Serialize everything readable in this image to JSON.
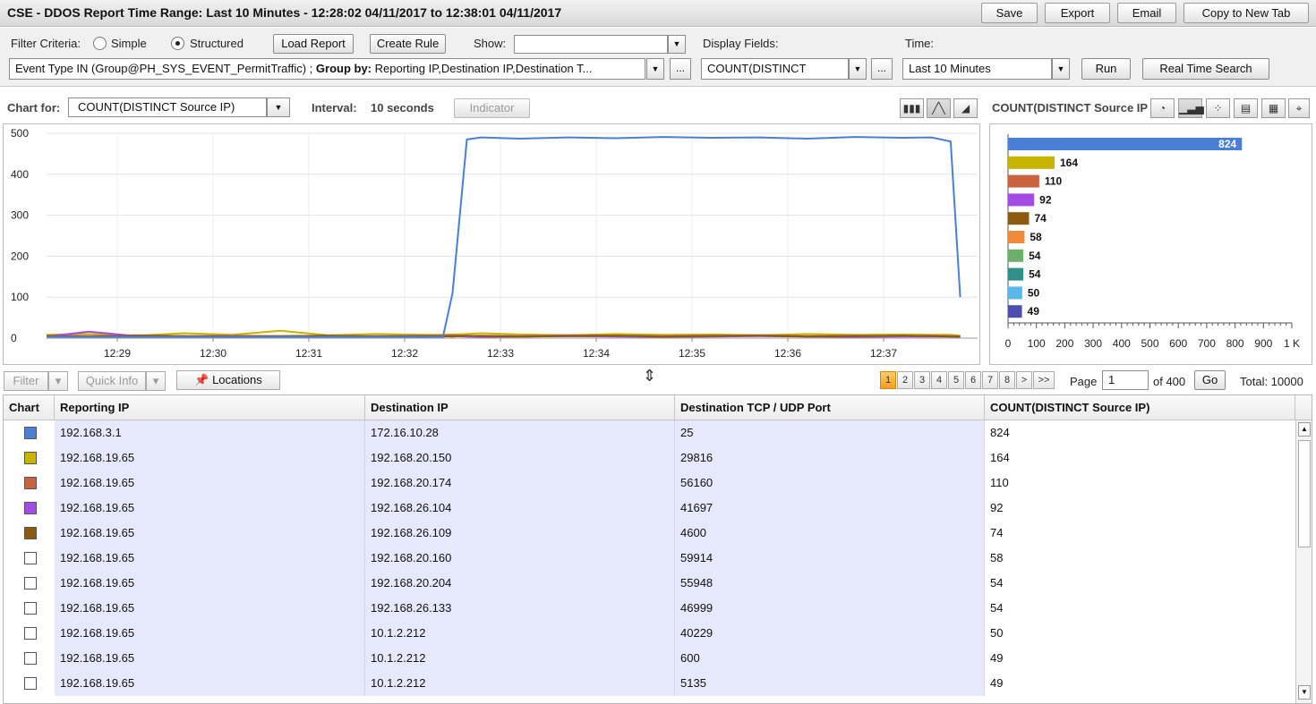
{
  "window": {
    "title": "CSE - DDOS Report  Time Range: Last 10 Minutes - 12:28:02 04/11/2017 to 12:38:01 04/11/2017",
    "buttons": {
      "save": "Save",
      "export": "Export",
      "email": "Email",
      "copy": "Copy to New Tab"
    }
  },
  "filter": {
    "label": "Filter Criteria:",
    "simple": "Simple",
    "structured": "Structured",
    "selected_mode": "Structured",
    "load_report": "Load Report",
    "create_rule": "Create Rule",
    "show_label": "Show:",
    "show_value": "",
    "criteria_prefix": "Event Type IN (Group@PH_SYS_EVENT_PermitTraffic) ; ",
    "group_by_label": "Group by:",
    "group_by_value": " Reporting IP,Destination IP,Destination T...",
    "display_fields_label": "Display Fields:",
    "display_fields_value": "COUNT(DISTINCT",
    "time_label": "Time:",
    "time_value": "Last 10 Minutes",
    "run": "Run",
    "real_time_search": "Real Time Search",
    "ellipsis": "..."
  },
  "chart_controls": {
    "chart_for_label": "Chart for:",
    "chart_for_value": "COUNT(DISTINCT Source IP)",
    "interval_label": "Interval:",
    "interval_value": "10 seconds",
    "indicator": "Indicator",
    "side_title": "COUNT(DISTINCT Source IP",
    "cursor_glyph": "⇕"
  },
  "chart_data": [
    {
      "type": "line",
      "title": "",
      "xlabel": "",
      "ylabel": "",
      "ylim": [
        0,
        500
      ],
      "yticks": [
        "0",
        "100",
        "200",
        "300",
        "400",
        "500"
      ],
      "xticks": [
        "12:29",
        "12:30",
        "12:31",
        "12:32",
        "12:33",
        "12:34",
        "12:35",
        "12:36",
        "12:37"
      ],
      "grid": true,
      "x_minutes": [
        0,
        0.5,
        1.0,
        1.5,
        2.0,
        2.5,
        3.0,
        3.5,
        4.0,
        4.2,
        4.3,
        4.45,
        4.6,
        5.0,
        5.5,
        6.0,
        6.5,
        7.0,
        7.5,
        8.0,
        8.5,
        9.0,
        9.3,
        9.5,
        9.6
      ],
      "series": [
        {
          "color": "#4a7fd6",
          "values": [
            3,
            3,
            3,
            3,
            3,
            3,
            3,
            3,
            3,
            3,
            110,
            485,
            490,
            487,
            490,
            488,
            491,
            489,
            490,
            487,
            491,
            489,
            490,
            480,
            100
          ]
        },
        {
          "color": "#c8b400",
          "values": [
            8,
            10,
            6,
            12,
            8,
            18,
            7,
            10,
            8,
            8,
            9,
            10,
            12,
            9,
            7,
            10,
            8,
            9,
            7,
            10,
            8,
            9,
            8,
            8,
            6
          ]
        },
        {
          "color": "#c8623f",
          "values": [
            6,
            5,
            7,
            5,
            6,
            5,
            6,
            5,
            6,
            6,
            7,
            5,
            6,
            5,
            7,
            6,
            5,
            6,
            7,
            5,
            6,
            5,
            6,
            5,
            5
          ]
        },
        {
          "color": "#a44be6",
          "values": [
            4,
            16,
            5,
            4,
            3,
            4,
            5,
            4,
            3,
            4,
            5,
            4,
            3,
            4,
            5,
            4,
            3,
            4,
            5,
            4,
            3,
            4,
            4,
            4,
            3
          ]
        },
        {
          "color": "#8b5a10",
          "values": [
            5,
            4,
            6,
            5,
            4,
            5,
            6,
            4,
            5,
            5,
            4,
            6,
            5,
            4,
            5,
            6,
            4,
            5,
            6,
            4,
            5,
            6,
            5,
            4,
            4
          ]
        }
      ]
    },
    {
      "type": "bar",
      "orientation": "horizontal",
      "values": [
        824,
        164,
        110,
        92,
        74,
        58,
        54,
        54,
        50,
        49
      ],
      "colors": [
        "#4a7fd6",
        "#c8b400",
        "#c8623f",
        "#a44be6",
        "#8b5a10",
        "#ef8a3a",
        "#6cb06c",
        "#2f8f8a",
        "#5ab8e8",
        "#4a4fb0"
      ],
      "xlim": [
        0,
        1000
      ],
      "xticks": [
        "0",
        "100",
        "200",
        "300",
        "400",
        "500",
        "600",
        "700",
        "800",
        "900",
        "1 K"
      ]
    }
  ],
  "grid_controls": {
    "filter": "Filter",
    "quick_info": "Quick Info",
    "locations": "Locations",
    "pages": [
      "1",
      "2",
      "3",
      "4",
      "5",
      "6",
      "7",
      "8",
      ">",
      ">>"
    ],
    "page_label": "Page",
    "page_value": "1",
    "of_label": "of 400",
    "go": "Go",
    "total": "Total: 10000"
  },
  "table": {
    "columns": [
      "Chart",
      "Reporting IP",
      "Destination IP",
      "Destination TCP / UDP Port",
      "COUNT(DISTINCT Source IP)"
    ],
    "rows": [
      {
        "color": "#4a7fd6",
        "reporting_ip": "192.168.3.1",
        "destination_ip": "172.16.10.28",
        "port": "25",
        "count": "824"
      },
      {
        "color": "#c8b400",
        "reporting_ip": "192.168.19.65",
        "destination_ip": "192.168.20.150",
        "port": "29816",
        "count": "164"
      },
      {
        "color": "#c8623f",
        "reporting_ip": "192.168.19.65",
        "destination_ip": "192.168.20.174",
        "port": "56160",
        "count": "110"
      },
      {
        "color": "#a44be6",
        "reporting_ip": "192.168.19.65",
        "destination_ip": "192.168.26.104",
        "port": "41697",
        "count": "92"
      },
      {
        "color": "#8b5a10",
        "reporting_ip": "192.168.19.65",
        "destination_ip": "192.168.26.109",
        "port": "4600",
        "count": "74"
      },
      {
        "color": "",
        "reporting_ip": "192.168.19.65",
        "destination_ip": "192.168.20.160",
        "port": "59914",
        "count": "58"
      },
      {
        "color": "",
        "reporting_ip": "192.168.19.65",
        "destination_ip": "192.168.20.204",
        "port": "55948",
        "count": "54"
      },
      {
        "color": "",
        "reporting_ip": "192.168.19.65",
        "destination_ip": "192.168.26.133",
        "port": "46999",
        "count": "54"
      },
      {
        "color": "",
        "reporting_ip": "192.168.19.65",
        "destination_ip": "10.1.2.212",
        "port": "40229",
        "count": "50"
      },
      {
        "color": "",
        "reporting_ip": "192.168.19.65",
        "destination_ip": "10.1.2.212",
        "port": "600",
        "count": "49"
      },
      {
        "color": "",
        "reporting_ip": "192.168.19.65",
        "destination_ip": "10.1.2.212",
        "port": "5135",
        "count": "49"
      }
    ]
  }
}
